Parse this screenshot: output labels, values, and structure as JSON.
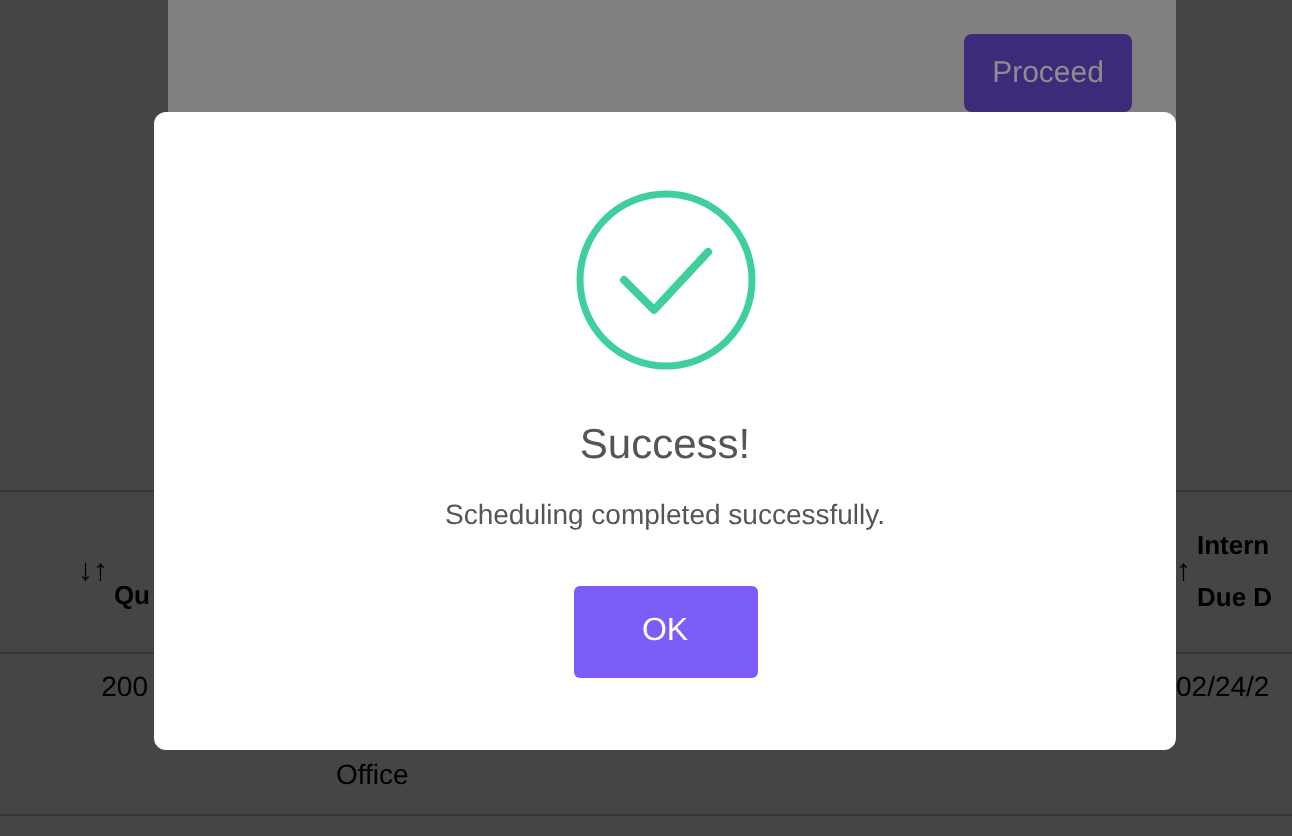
{
  "table": {
    "columns": [
      {
        "label": "Qu",
        "sort_icon": "↓↑"
      },
      {},
      {
        "label": "Intern\nDue D",
        "sort_icon": "↑"
      }
    ],
    "rows": [
      {
        "cells": [
          "200",
          "Office",
          "02/24/2"
        ]
      }
    ]
  },
  "background_dialog": {
    "button": "Proceed"
  },
  "dialog": {
    "title": "Success!",
    "message": "Scheduling completed successfully.",
    "button": "OK"
  }
}
